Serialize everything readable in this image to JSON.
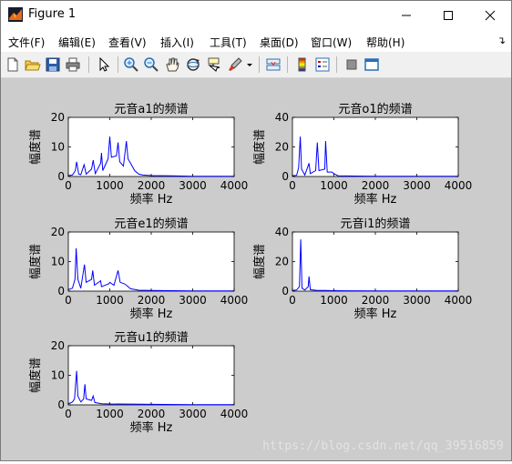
{
  "window": {
    "title": "Figure 1"
  },
  "menu": [
    {
      "label": "文件(F)"
    },
    {
      "label": "编辑(E)"
    },
    {
      "label": "查看(V)"
    },
    {
      "label": "插入(I)"
    },
    {
      "label": "工具(T)"
    },
    {
      "label": "桌面(D)"
    },
    {
      "label": "窗口(W)"
    },
    {
      "label": "帮助(H)"
    }
  ],
  "toolbar": [
    {
      "icon": "new-figure-icon"
    },
    {
      "icon": "open-icon"
    },
    {
      "icon": "save-icon"
    },
    {
      "icon": "print-icon"
    },
    {
      "icon": "pointer-icon"
    },
    {
      "icon": "zoom-in-icon"
    },
    {
      "icon": "zoom-out-icon"
    },
    {
      "icon": "pan-icon"
    },
    {
      "icon": "rotate-icon"
    },
    {
      "icon": "data-cursor-icon"
    },
    {
      "icon": "brush-icon"
    },
    {
      "icon": "link-icon"
    },
    {
      "icon": "colorbar-icon"
    },
    {
      "icon": "legend-icon"
    },
    {
      "icon": "hide-tools-icon"
    },
    {
      "icon": "dock-icon"
    }
  ],
  "colors": {
    "series": "#0000ff",
    "figure_bg": "#cccccc"
  },
  "watermark": "https://blog.csdn.net/qq_39516859",
  "chart_data": [
    {
      "type": "line",
      "title": "元音a1的频谱",
      "xlabel": "频率 Hz",
      "ylabel": "幅度谱",
      "xlim": [
        0,
        4000
      ],
      "ylim": [
        0,
        20
      ],
      "xticks": [
        "0",
        "1000",
        "2000",
        "3000",
        "4000"
      ],
      "yticks": [
        "0",
        "10",
        "20"
      ],
      "peaks": [
        [
          0,
          0.3
        ],
        [
          100,
          0.5
        ],
        [
          170,
          2
        ],
        [
          200,
          5
        ],
        [
          250,
          0.8
        ],
        [
          300,
          0.6
        ],
        [
          380,
          4
        ],
        [
          430,
          0.8
        ],
        [
          560,
          2.5
        ],
        [
          600,
          5.5
        ],
        [
          650,
          1.0
        ],
        [
          780,
          4.5
        ],
        [
          800,
          8
        ],
        [
          830,
          2
        ],
        [
          960,
          6
        ],
        [
          1000,
          13.5
        ],
        [
          1040,
          6.5
        ],
        [
          1160,
          7
        ],
        [
          1200,
          11.5
        ],
        [
          1240,
          5
        ],
        [
          1330,
          3.5
        ],
        [
          1400,
          12
        ],
        [
          1440,
          6
        ],
        [
          1500,
          4.5
        ],
        [
          1600,
          2
        ],
        [
          1700,
          0.8
        ],
        [
          1800,
          0.5
        ],
        [
          2000,
          0.3
        ],
        [
          2500,
          0.2
        ],
        [
          3000,
          0.1
        ],
        [
          3500,
          0.1
        ],
        [
          4000,
          0.1
        ]
      ]
    },
    {
      "type": "line",
      "title": "元音o1的频谱",
      "xlabel": "频率 Hz",
      "ylabel": "幅度谱",
      "xlim": [
        0,
        4000
      ],
      "ylim": [
        0,
        40
      ],
      "xticks": [
        "0",
        "1000",
        "2000",
        "3000",
        "4000"
      ],
      "yticks": [
        "0",
        "20",
        "40"
      ],
      "peaks": [
        [
          0,
          0.5
        ],
        [
          100,
          0.8
        ],
        [
          150,
          6
        ],
        [
          190,
          27
        ],
        [
          220,
          5
        ],
        [
          300,
          1
        ],
        [
          400,
          9
        ],
        [
          430,
          2
        ],
        [
          560,
          4
        ],
        [
          600,
          23
        ],
        [
          640,
          4
        ],
        [
          780,
          5
        ],
        [
          800,
          24
        ],
        [
          840,
          3
        ],
        [
          950,
          3
        ],
        [
          1000,
          2
        ],
        [
          1100,
          0.5
        ],
        [
          1500,
          0.3
        ],
        [
          2000,
          0.2
        ],
        [
          3000,
          0.1
        ],
        [
          4000,
          0.1
        ]
      ]
    },
    {
      "type": "line",
      "title": "元音e1的频谱",
      "xlabel": "频率 Hz",
      "ylabel": "幅度谱",
      "xlim": [
        0,
        4000
      ],
      "ylim": [
        0,
        20
      ],
      "xticks": [
        "0",
        "1000",
        "2000",
        "3000",
        "4000"
      ],
      "yticks": [
        "0",
        "10",
        "20"
      ],
      "peaks": [
        [
          0,
          0.5
        ],
        [
          100,
          1
        ],
        [
          160,
          4
        ],
        [
          190,
          14.5
        ],
        [
          230,
          4
        ],
        [
          300,
          1
        ],
        [
          390,
          9
        ],
        [
          430,
          3
        ],
        [
          560,
          4
        ],
        [
          590,
          7
        ],
        [
          630,
          2
        ],
        [
          780,
          3.5
        ],
        [
          800,
          1.5
        ],
        [
          980,
          2.5
        ],
        [
          1000,
          3
        ],
        [
          1100,
          2
        ],
        [
          1160,
          5
        ],
        [
          1200,
          7
        ],
        [
          1250,
          3
        ],
        [
          1350,
          2.5
        ],
        [
          1400,
          2
        ],
        [
          1500,
          0.8
        ],
        [
          1700,
          0.3
        ],
        [
          2000,
          0.2
        ],
        [
          3000,
          0.1
        ],
        [
          4000,
          0.1
        ]
      ]
    },
    {
      "type": "line",
      "title": "元音i1的频谱",
      "xlabel": "频率 Hz",
      "ylabel": "幅度谱",
      "xlim": [
        0,
        4000
      ],
      "ylim": [
        0,
        40
      ],
      "xticks": [
        "0",
        "1000",
        "2000",
        "3000",
        "4000"
      ],
      "yticks": [
        "0",
        "20",
        "40"
      ],
      "peaks": [
        [
          0,
          0.5
        ],
        [
          100,
          0.8
        ],
        [
          170,
          3
        ],
        [
          200,
          35
        ],
        [
          230,
          2
        ],
        [
          300,
          0.8
        ],
        [
          380,
          3
        ],
        [
          400,
          10
        ],
        [
          430,
          1
        ],
        [
          600,
          0.5
        ],
        [
          800,
          0.4
        ],
        [
          1000,
          0.3
        ],
        [
          2000,
          0.2
        ],
        [
          3000,
          0.1
        ],
        [
          4000,
          0.1
        ]
      ]
    },
    {
      "type": "line",
      "title": "元音u1的频谱",
      "xlabel": "频率 Hz",
      "ylabel": "幅度谱",
      "xlim": [
        0,
        4000
      ],
      "ylim": [
        0,
        20
      ],
      "xticks": [
        "0",
        "1000",
        "2000",
        "3000",
        "4000"
      ],
      "yticks": [
        "0",
        "10",
        "20"
      ],
      "peaks": [
        [
          0,
          0.3
        ],
        [
          100,
          1
        ],
        [
          150,
          2
        ],
        [
          200,
          11.5
        ],
        [
          230,
          3
        ],
        [
          300,
          1
        ],
        [
          370,
          2
        ],
        [
          400,
          7
        ],
        [
          430,
          2
        ],
        [
          560,
          1.5
        ],
        [
          600,
          3
        ],
        [
          640,
          0.8
        ],
        [
          800,
          0.4
        ],
        [
          1000,
          0.3
        ],
        [
          2000,
          0.2
        ],
        [
          3000,
          0.1
        ],
        [
          4000,
          0.1
        ]
      ]
    }
  ]
}
